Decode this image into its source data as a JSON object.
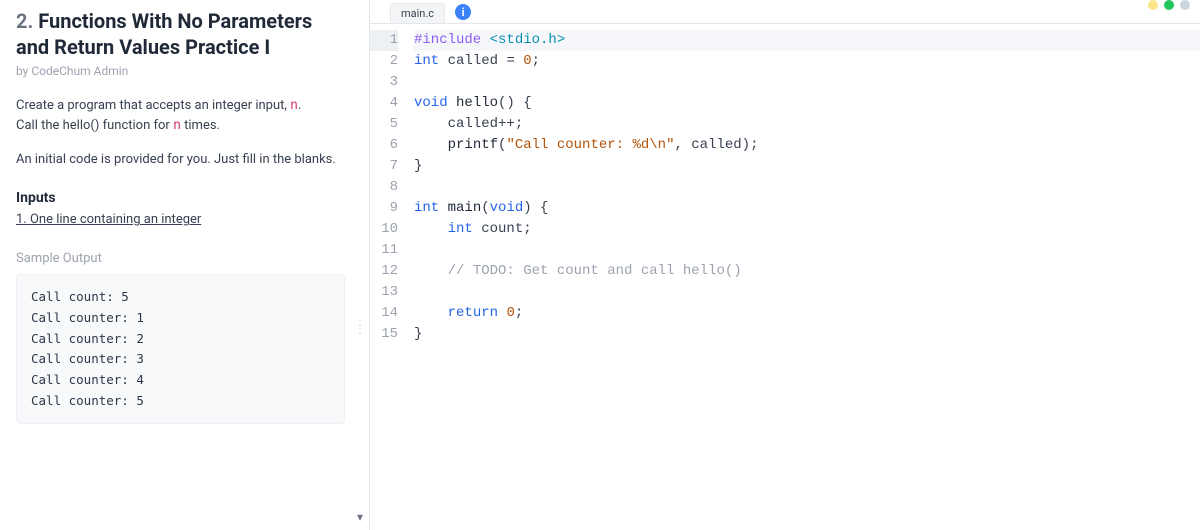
{
  "problem": {
    "number": "2.",
    "title": "Functions With No Parameters and Return Values Practice I",
    "byline": "by CodeChum Admin",
    "desc1_a": "Create a program that accepts an integer input, ",
    "desc1_n": "n",
    "desc1_b": ".",
    "desc2_a": "Call the hello() function for ",
    "desc2_n": "n",
    "desc2_b": " times.",
    "desc3": "An initial code is provided for you. Just fill in the blanks.",
    "inputs_h": "Inputs",
    "inputs_line": "1. One line containing an integer",
    "sample_label": "Sample Output",
    "sample_output": "Call count: 5\nCall counter: 1\nCall counter: 2\nCall counter: 3\nCall counter: 4\nCall counter: 5"
  },
  "editor": {
    "filename": "main.c",
    "lines": [
      [
        [
          "pre",
          "#include "
        ],
        [
          "inc",
          "<stdio.h>"
        ]
      ],
      [
        [
          "kw",
          "int"
        ],
        [
          "id",
          " called "
        ],
        [
          "id",
          "= "
        ],
        [
          "num",
          "0"
        ],
        [
          "id",
          ";"
        ]
      ],
      [],
      [
        [
          "kw",
          "void"
        ],
        [
          "id",
          " "
        ],
        [
          "fn",
          "hello"
        ],
        [
          "id",
          "() {"
        ]
      ],
      [
        [
          "id",
          "    called++;"
        ]
      ],
      [
        [
          "id",
          "    "
        ],
        [
          "fn",
          "printf"
        ],
        [
          "id",
          "("
        ],
        [
          "str",
          "\"Call counter: %d\\n\""
        ],
        [
          "id",
          ", called);"
        ]
      ],
      [
        [
          "id",
          "}"
        ]
      ],
      [],
      [
        [
          "kw",
          "int"
        ],
        [
          "id",
          " "
        ],
        [
          "fn",
          "main"
        ],
        [
          "id",
          "("
        ],
        [
          "kw",
          "void"
        ],
        [
          "id",
          ") {"
        ]
      ],
      [
        [
          "id",
          "    "
        ],
        [
          "kw",
          "int"
        ],
        [
          "id",
          " count;"
        ]
      ],
      [],
      [
        [
          "id",
          "    "
        ],
        [
          "cmt",
          "// TODO: Get count and call hello()"
        ]
      ],
      [],
      [
        [
          "id",
          "    "
        ],
        [
          "kw",
          "return"
        ],
        [
          "id",
          " "
        ],
        [
          "num",
          "0"
        ],
        [
          "id",
          ";"
        ]
      ],
      [
        [
          "id",
          "}"
        ]
      ]
    ],
    "highlight_line": 1
  },
  "icons": {
    "info": "i",
    "chevron": "▾"
  }
}
